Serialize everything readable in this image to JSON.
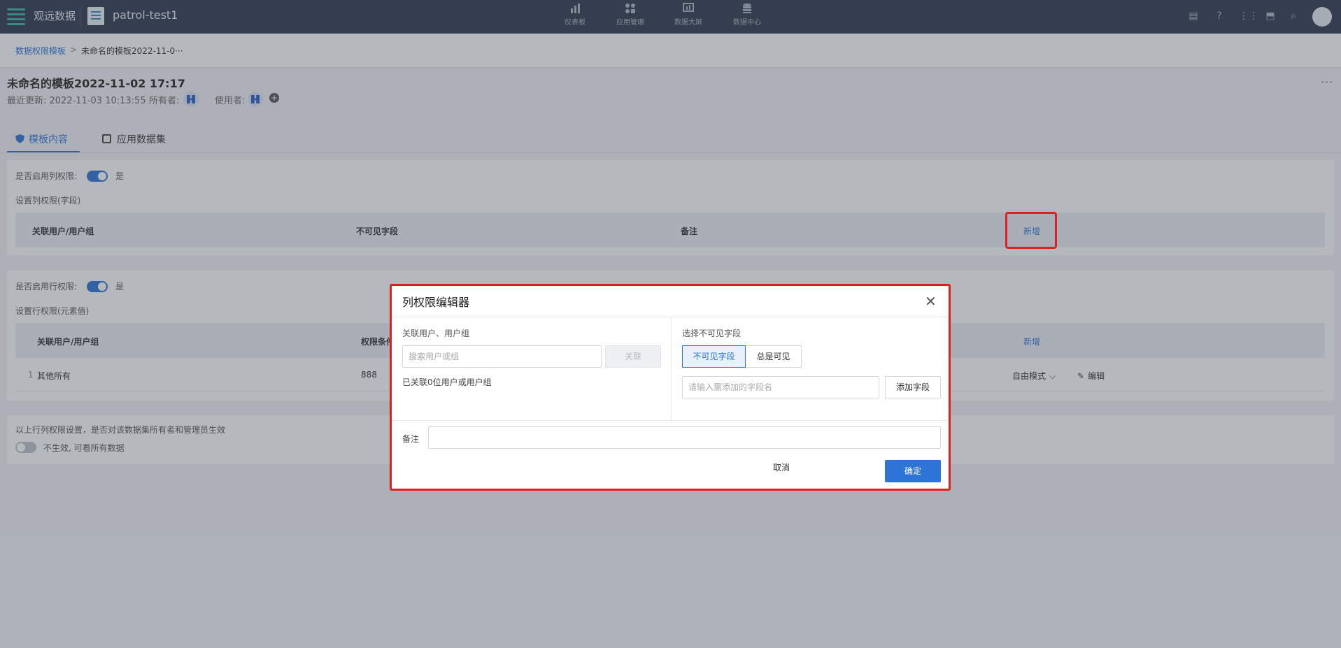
{
  "topbar": {
    "brand": "观远数据",
    "project_name": "patrol-test1",
    "nav": [
      {
        "label": "仪表板",
        "icon": "bar-chart-icon"
      },
      {
        "label": "应用管理",
        "icon": "apps-icon"
      },
      {
        "label": "数据大屏",
        "icon": "screen-icon"
      },
      {
        "label": "数据中心",
        "icon": "database-icon"
      }
    ]
  },
  "breadcrumb": {
    "parent": "数据权限模板",
    "separator": ">",
    "current": "未命名的模板2022-11-0···"
  },
  "header": {
    "title": "未命名的模板2022-11-02 17:17",
    "last_updated": "最近更新: 2022-11-03 10:13:55",
    "owner_label": "所有者:",
    "user_label": "使用者:",
    "more": "···"
  },
  "tabs": [
    {
      "label": "模板内容",
      "active": true
    },
    {
      "label": "应用数据集",
      "active": false
    }
  ],
  "column_perm": {
    "enable_label": "是否启用列权限:",
    "enable_value": "是",
    "section_label": "设置列权限(字段)",
    "headers": [
      "关联用户/用户组",
      "不可见字段",
      "备注"
    ],
    "add_label": "新增"
  },
  "row_perm": {
    "enable_label": "是否启用行权限:",
    "enable_value": "是",
    "section_label": "设置行权限(元素值)",
    "headers": [
      "关联用户/用户组",
      "权限条件"
    ],
    "add_label": "新增",
    "rows": [
      {
        "index": "1",
        "user": "其他所有",
        "condition": "888",
        "mode": "自由模式",
        "edit": "编辑"
      }
    ]
  },
  "owner_effect": {
    "label": "以上行列权限设置，是否对该数据集所有者和管理员生效",
    "toggle_text": "不生效, 可看所有数据"
  },
  "modal": {
    "title": "列权限编辑器",
    "left_label": "关联用户、用户组",
    "search_placeholder": "搜索用户或组",
    "link_button": "关联",
    "linked_count": "已关联0位用户或用户组",
    "right_label": "选择不可见字段",
    "seg_invisible": "不可见字段",
    "seg_visible": "总是可见",
    "field_placeholder": "请输入需添加的字段名",
    "add_field_button": "添加字段",
    "note_label": "备注",
    "cancel": "取消",
    "confirm": "确定"
  },
  "colors": {
    "accent": "#2e74d6",
    "topbar": "#2f3a4d",
    "highlight": "#e02020"
  }
}
